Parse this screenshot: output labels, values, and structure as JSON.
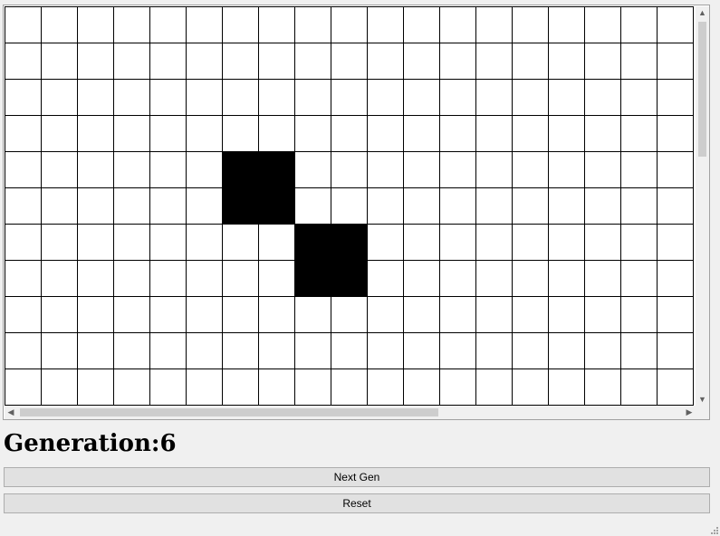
{
  "grid": {
    "columns_visible": 19,
    "rows_visible": 11,
    "alive_cells": [
      [
        6,
        4
      ],
      [
        7,
        4
      ],
      [
        6,
        5
      ],
      [
        7,
        5
      ],
      [
        8,
        6
      ],
      [
        9,
        6
      ],
      [
        8,
        7
      ],
      [
        9,
        7
      ]
    ],
    "cell_color_alive": "#000000",
    "cell_color_dead": "#ffffff",
    "line_color": "#000000"
  },
  "scrollbars": {
    "vertical": {
      "up_icon": "▲",
      "down_icon": "▼"
    },
    "horizontal": {
      "left_icon": "◀",
      "right_icon": "▶"
    }
  },
  "status": {
    "generation_label": "Generation:",
    "generation_value": "6"
  },
  "buttons": {
    "next_gen_label": "Next Gen",
    "reset_label": "Reset"
  }
}
